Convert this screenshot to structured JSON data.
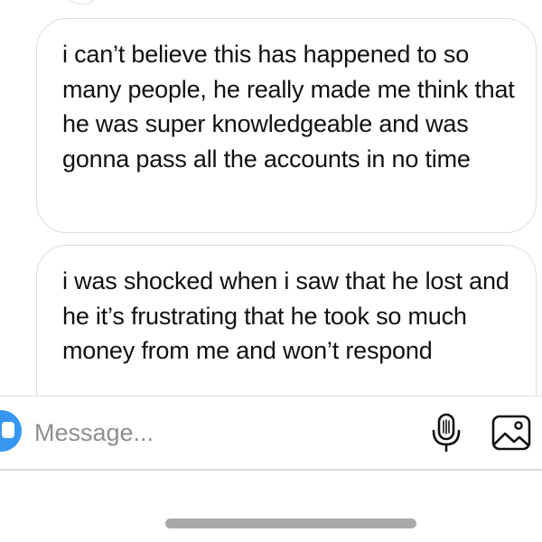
{
  "thread": {
    "messages": [
      {
        "text": "i can’t believe this has happened to so many people, he really made me think that he was super knowledgeable and was gonna pass all the accounts in no time"
      },
      {
        "text": "i was shocked when i saw that he lost and he it’s frustrating that he took so much money from me and won’t respond"
      }
    ]
  },
  "composer": {
    "placeholder": "Message...",
    "accent_color": "#3797f0",
    "icons": {
      "left": "camera-icon",
      "mic": "microphone-icon",
      "gallery": "gallery-icon"
    }
  }
}
